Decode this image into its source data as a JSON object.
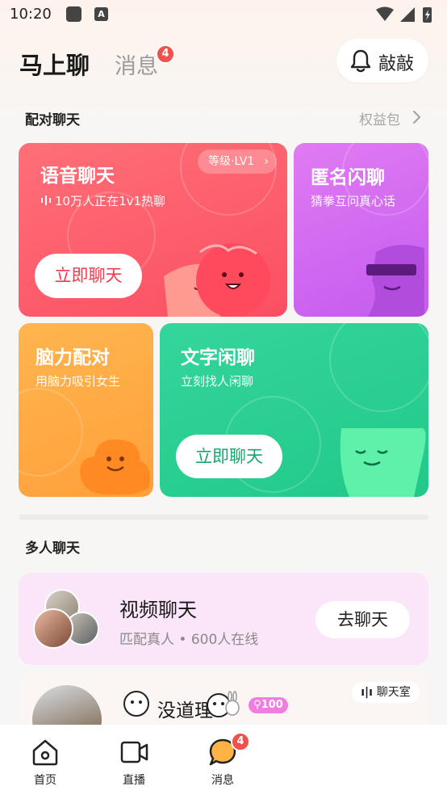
{
  "status_bar": {
    "time": "10:20"
  },
  "header": {
    "title": "马上聊",
    "tab_messages": "消息",
    "messages_badge": "4",
    "knock_label": "敲敲"
  },
  "pairing": {
    "section_title": "配对聊天",
    "rights_label": "权益包",
    "voice": {
      "title": "语音聊天",
      "subtitle": "10万人正在1v1热聊",
      "level": "等级·LV1",
      "button": "立即聊天"
    },
    "anonymous": {
      "title": "匿名闪聊",
      "subtitle": "猜拳互问真心话"
    },
    "brain": {
      "title": "脑力配对",
      "subtitle": "用脑力吸引女生"
    },
    "text_chat": {
      "title": "文字闲聊",
      "subtitle": "立刻找人闲聊",
      "button": "立即聊天"
    }
  },
  "group": {
    "section_title": "多人聊天",
    "video": {
      "title": "视频聊天",
      "subtitle": "匹配真人 • 600人在线",
      "button": "去聊天"
    },
    "room": {
      "name": "没道理",
      "badge": "100",
      "tag": "聊天室"
    }
  },
  "bottom_nav": {
    "home": "首页",
    "live": "直播",
    "messages": "消息",
    "messages_badge": "4"
  },
  "colors": {
    "voice_card": "#fb5a69",
    "anonymous_card": "#d56cf1",
    "brain_card": "#ffa843",
    "text_card": "#2acf92",
    "badge": "#f0514a",
    "video_card_bg": "#fbe5f8"
  }
}
